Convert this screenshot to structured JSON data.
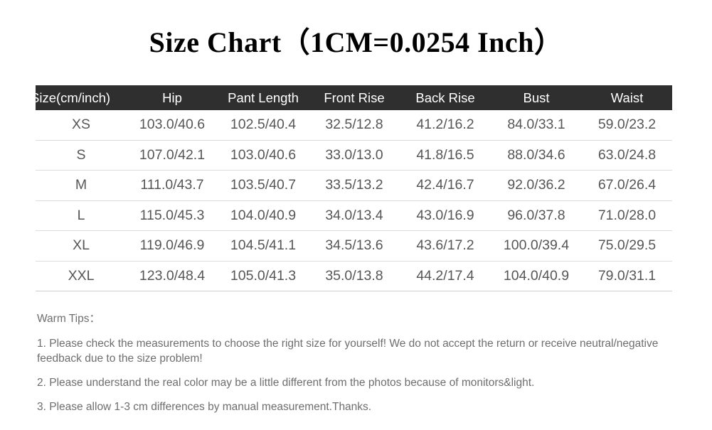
{
  "title": "Size Chart（1CM=0.0254 Inch）",
  "table": {
    "columns": [
      "Size(cm/inch)",
      "Hip",
      "Pant Length",
      "Front Rise",
      "Back Rise",
      "Bust",
      "Waist"
    ],
    "rows": [
      [
        "XS",
        "103.0/40.6",
        "102.5/40.4",
        "32.5/12.8",
        "41.2/16.2",
        "84.0/33.1",
        "59.0/23.2"
      ],
      [
        "S",
        "107.0/42.1",
        "103.0/40.6",
        "33.0/13.0",
        "41.8/16.5",
        "88.0/34.6",
        "63.0/24.8"
      ],
      [
        "M",
        "111.0/43.7",
        "103.5/40.7",
        "33.5/13.2",
        "42.4/16.7",
        "92.0/36.2",
        "67.0/26.4"
      ],
      [
        "L",
        "115.0/45.3",
        "104.0/40.9",
        "34.0/13.4",
        "43.0/16.9",
        "96.0/37.8",
        "71.0/28.0"
      ],
      [
        "XL",
        "119.0/46.9",
        "104.5/41.1",
        "34.5/13.6",
        "43.6/17.2",
        "100.0/39.4",
        "75.0/29.5"
      ],
      [
        "XXL",
        "123.0/48.4",
        "105.0/41.3",
        "35.0/13.8",
        "44.2/17.4",
        "104.0/40.9",
        "79.0/31.1"
      ]
    ]
  },
  "tips": {
    "heading": "Warm Tips：",
    "items": [
      "1. Please check the measurements to choose the right size for yourself! We do not accept the return or receive neutral/negative feedback due to the size problem!",
      "2. Please understand the real color may be a little different from the photos because of monitors&light.",
      "3. Please allow 1-3 cm differences by manual measurement.Thanks."
    ]
  },
  "colors": {
    "header_bar": "#2f2f30",
    "header_text": "#ffffff",
    "body_text": "#565656",
    "tips_text": "#6e6e6e",
    "row_divider": "#dcdcdc",
    "background": "#ffffff"
  }
}
